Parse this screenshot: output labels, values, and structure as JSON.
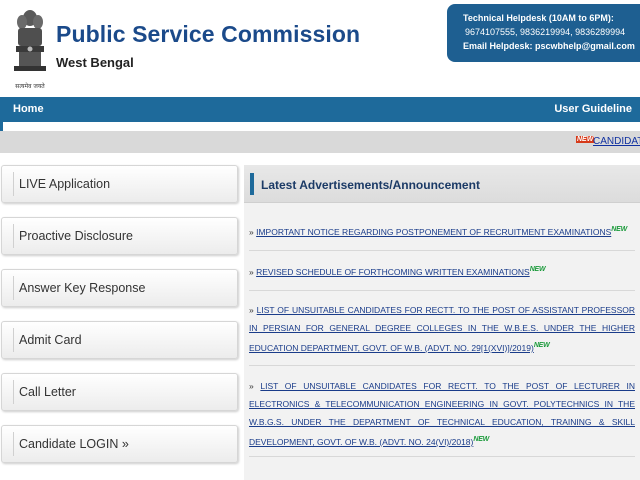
{
  "header": {
    "title": "Public Service Commission",
    "subtitle": "West Bengal",
    "emblem_motto": "सत्यमेव जयते"
  },
  "helpdesk": {
    "heading": "Technical Helpdesk (10AM to 6PM):",
    "phones": "9674107555, 9836219994, 9836289994",
    "email": "Email Helpdesk: pscwbhelp@gmail.com"
  },
  "nav": {
    "home": "Home",
    "guide": "User Guideline"
  },
  "greybar": {
    "new_badge": "NEW",
    "candidate_link": "CANDIDATE"
  },
  "sidebar": {
    "items": [
      {
        "label": "LIVE Application"
      },
      {
        "label": "Proactive Disclosure"
      },
      {
        "label": "Answer Key Response"
      },
      {
        "label": "Admit Card"
      },
      {
        "label": "Call Letter"
      },
      {
        "label": "Candidate LOGIN »"
      }
    ]
  },
  "main": {
    "heading": "Latest Advertisements/Announcement",
    "bullet": "»",
    "new_tag": "NEW",
    "ads": [
      {
        "text": "IMPORTANT NOTICE REGARDING POSTPONEMENT OF RECRUITMENT EXAMINATIONS"
      },
      {
        "text": "REVISED SCHEDULE OF FORTHCOMING WRITTEN EXAMINATIONS"
      },
      {
        "text": "LIST OF UNSUITABLE CANDIDATES FOR RECTT. TO THE POST OF ASSISTANT PROFESSOR IN PERSIAN FOR GENERAL DEGREE COLLEGES IN THE W.B.E.S. UNDER THE HIGHER EDUCATION DEPARTMENT, GOVT. OF W.B. (ADVT. NO. 29[1(XVI)]/2019)"
      },
      {
        "text": "LIST OF UNSUITABLE CANDIDATES FOR RECTT. TO THE POST OF LECTURER IN ELECTRONICS & TELECOMMUNICATION ENGINEERING IN GOVT. POLYTECHNICS IN THE W.B.G.S. UNDER THE DEPARTMENT OF TECHNICAL EDUCATION, TRAINING & SKILL DEVELOPMENT, GOVT. OF W.B. (ADVT. NO. 24(VI)/2018)"
      }
    ]
  },
  "colors": {
    "brand_blue": "#1e6a9b",
    "title_blue": "#1b4a8a",
    "link_blue": "#1a3c8a"
  }
}
